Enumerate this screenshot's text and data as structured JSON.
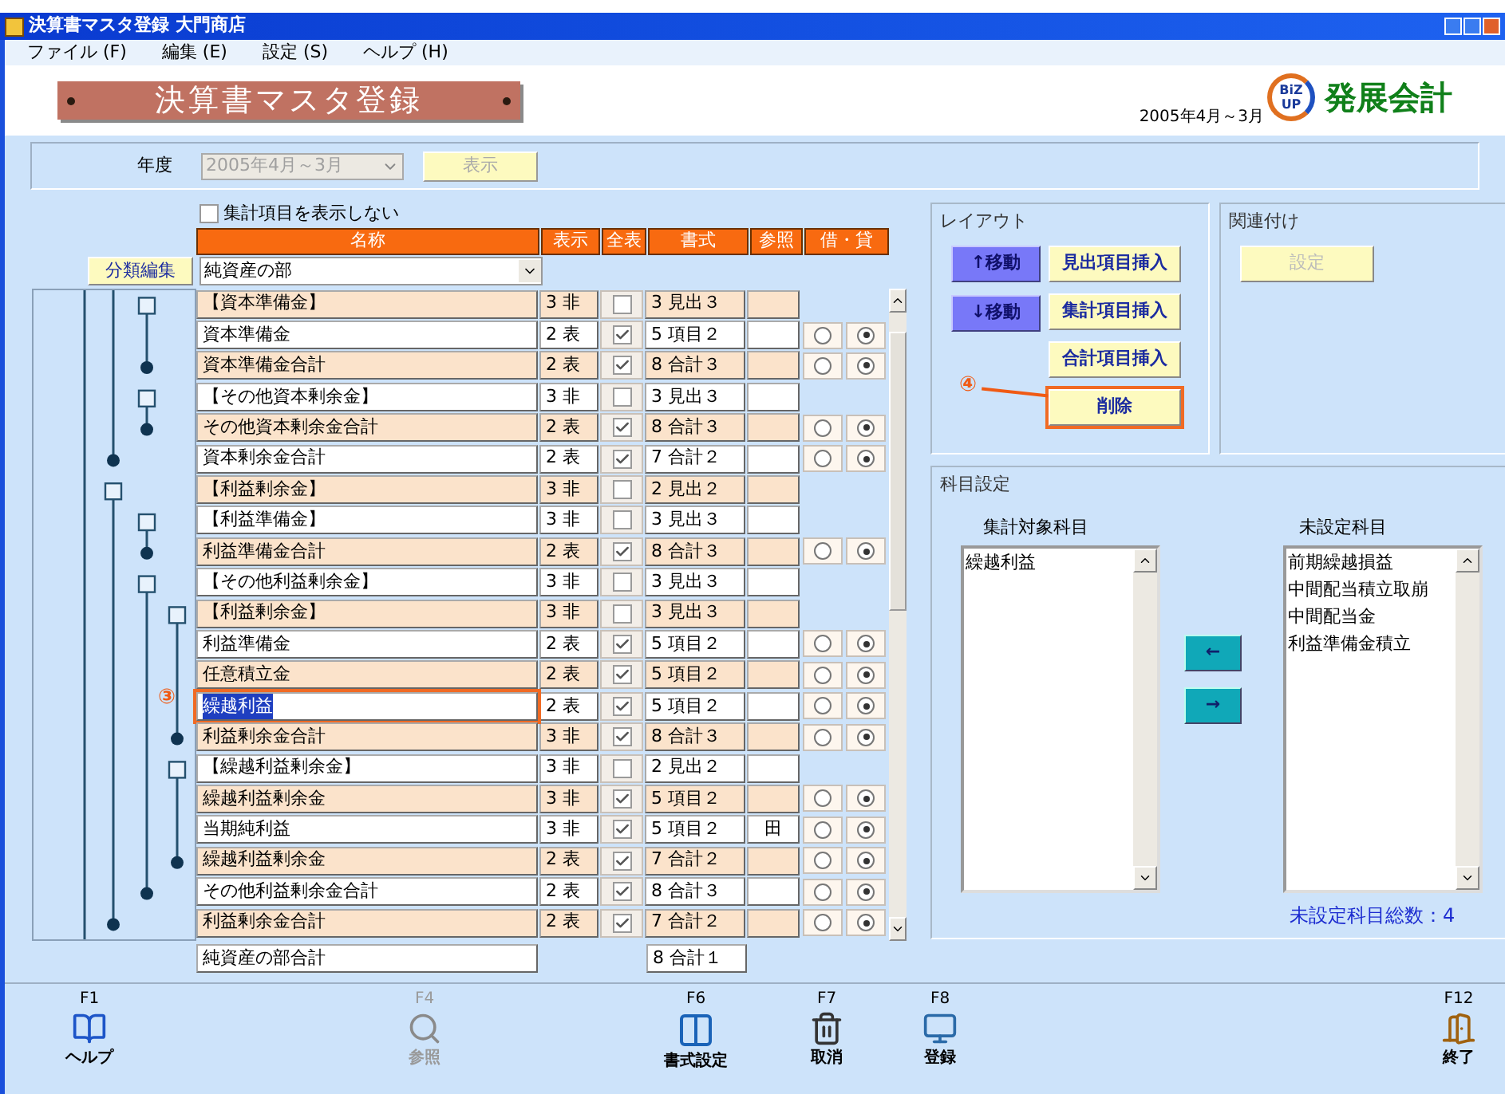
{
  "window": {
    "title": "決算書マスタ登録 大門商店"
  },
  "menu": [
    "ファイル (F)",
    "編集 (E)",
    "設定 (S)",
    "ヘルプ (H)"
  ],
  "banner": {
    "title": "決算書マスタ登録",
    "period": "2005年4月～3月",
    "logo_top": "BiZ",
    "logo_bottom": "UP",
    "brand": "発展会計"
  },
  "year_filter": {
    "label": "年度",
    "value": "2005年4月～3月",
    "disabled": true,
    "button": "表示"
  },
  "hide_totals": {
    "label": "集計項目を表示しない",
    "checked": false
  },
  "table": {
    "columns": [
      "名称",
      "表示",
      "全表",
      "書式",
      "参照",
      "借・貸"
    ],
    "category_button": "分類編集",
    "category": "純資産の部",
    "rows": [
      {
        "name": "【資本準備金】",
        "display": "3 非",
        "all": false,
        "format": "3 見出３",
        "selected": false
      },
      {
        "name": "資本準備金",
        "display": "2 表",
        "all": true,
        "format": "5 項目２",
        "selected": false,
        "side": [
          {
            "selected": false
          },
          {
            "selected": true
          }
        ]
      },
      {
        "name": "資本準備金合計",
        "display": "2 表",
        "all": true,
        "format": "8 合計３",
        "selected": false,
        "side": [
          {
            "selected": false
          },
          {
            "selected": true
          }
        ]
      },
      {
        "name": "【その他資本剰余金】",
        "display": "3 非",
        "all": false,
        "format": "3 見出３",
        "selected": false
      },
      {
        "name": "その他資本剰余金合計",
        "display": "2 表",
        "all": true,
        "format": "8 合計３",
        "selected": false,
        "side": [
          {
            "selected": false
          },
          {
            "selected": true
          }
        ]
      },
      {
        "name": "資本剰余金合計",
        "display": "2 表",
        "all": true,
        "format": "7 合計２",
        "selected": false,
        "side": [
          {
            "selected": false
          },
          {
            "selected": true
          }
        ]
      },
      {
        "name": "【利益剰余金】",
        "display": "3 非",
        "all": false,
        "format": "2 見出２",
        "selected": false
      },
      {
        "name": "【利益準備金】",
        "display": "3 非",
        "all": false,
        "format": "3 見出３",
        "selected": false
      },
      {
        "name": "利益準備金合計",
        "display": "2 表",
        "all": true,
        "format": "8 合計３",
        "selected": false,
        "side": [
          {
            "selected": false
          },
          {
            "selected": true
          }
        ]
      },
      {
        "name": "【その他利益剰余金】",
        "display": "3 非",
        "all": false,
        "format": "3 見出３",
        "selected": false
      },
      {
        "name": "【利益剰余金】",
        "display": "3 非",
        "all": false,
        "format": "3 見出３",
        "selected": false
      },
      {
        "name": "利益準備金",
        "display": "2 表",
        "all": true,
        "format": "5 項目２",
        "selected": false,
        "side": [
          {
            "selected": false
          },
          {
            "selected": true
          }
        ]
      },
      {
        "name": "任意積立金",
        "display": "2 表",
        "all": true,
        "format": "5 項目２",
        "selected": false,
        "side": [
          {
            "selected": false
          },
          {
            "selected": true
          }
        ]
      },
      {
        "name": "繰越利益",
        "display": "2 表",
        "all": true,
        "format": "5 項目２",
        "selected": true,
        "marker": "③",
        "side": [
          {
            "selected": false
          },
          {
            "selected": true
          }
        ]
      },
      {
        "name": "利益剰余金合計",
        "display": "3 非",
        "all": true,
        "format": "8 合計３",
        "selected": false,
        "side": [
          {
            "selected": false
          },
          {
            "selected": true
          }
        ]
      },
      {
        "name": "【繰越利益剰余金】",
        "display": "3 非",
        "all": false,
        "format": "2 見出２",
        "selected": false
      },
      {
        "name": "繰越利益剰余金",
        "display": "3 非",
        "all": true,
        "format": "5 項目２",
        "selected": false,
        "side": [
          {
            "selected": false
          },
          {
            "selected": true
          }
        ]
      },
      {
        "name": "当期純利益",
        "display": "3 非",
        "all": true,
        "format": "5 項目２",
        "ref": "田",
        "selected": false,
        "side": [
          {
            "selected": false
          },
          {
            "selected": true
          }
        ]
      },
      {
        "name": "繰越利益剰余金",
        "display": "2 表",
        "all": true,
        "format": "7 合計２",
        "selected": false,
        "side": [
          {
            "selected": false
          },
          {
            "selected": true
          }
        ]
      },
      {
        "name": "その他利益剰余金合計",
        "display": "2 表",
        "all": true,
        "format": "8 合計３",
        "selected": false,
        "side": [
          {
            "selected": false
          },
          {
            "selected": true
          }
        ]
      },
      {
        "name": "利益剰余金合計",
        "display": "2 表",
        "all": true,
        "format": "7 合計２",
        "selected": false,
        "side": [
          {
            "selected": false
          },
          {
            "selected": true
          }
        ]
      }
    ],
    "total": {
      "name": "純資産の部合計",
      "format": "8 合計１"
    }
  },
  "layout_panel": {
    "title": "レイアウト",
    "move_buttons": [
      "↑移動",
      "↓移動"
    ],
    "action_buttons": [
      {
        "label": "見出項目挿入"
      },
      {
        "label": "集計項目挿入"
      },
      {
        "label": "合計項目挿入"
      },
      {
        "label": "削除",
        "marker": "④"
      }
    ]
  },
  "link_panel": {
    "title": "関連付け",
    "button": "設定",
    "disabled": true
  },
  "account_panel": {
    "title": "科目設定",
    "target": {
      "title": "集計対象科目",
      "items": [
        "繰越利益"
      ]
    },
    "unset": {
      "title": "未設定科目",
      "items": [
        "前期繰越損益",
        "中間配当積立取崩",
        "中間配当金",
        "利益準備金積立"
      ]
    },
    "move_left": "←",
    "move_right": "→",
    "count": "未設定科目総数：4"
  },
  "function_keys": [
    {
      "key": "F1",
      "label": "ヘルプ",
      "kind": "help",
      "disabled": false
    },
    {
      "key": "F4",
      "label": "参照",
      "kind": "search",
      "disabled": true
    },
    {
      "key": "F6",
      "label": "書式設定",
      "kind": "format",
      "disabled": false
    },
    {
      "key": "F7",
      "label": "取消",
      "kind": "trash",
      "disabled": false
    },
    {
      "key": "F8",
      "label": "登録",
      "kind": "register",
      "disabled": false
    },
    {
      "key": "F12",
      "label": "終了",
      "kind": "exit",
      "disabled": false
    }
  ]
}
